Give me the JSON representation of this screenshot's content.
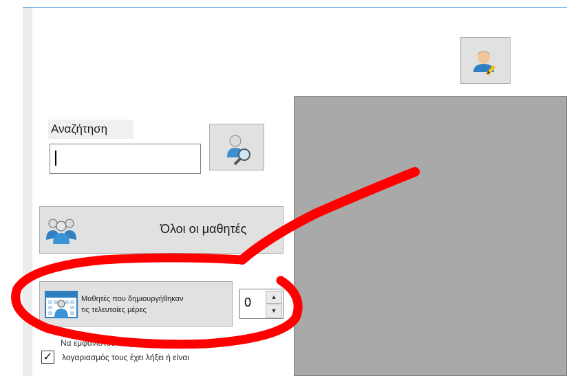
{
  "search": {
    "label": "Αναζήτηση",
    "value": "",
    "placeholder": ""
  },
  "buttons": {
    "all_students": "Όλοι οι μαθητές",
    "new_students_line1": "Μαθητές που δημιουργήθηκαν",
    "new_students_line2": "τις τελευταίες μέρες"
  },
  "days_spinner": {
    "value": "0",
    "up_glyph": "▲",
    "down_glyph": "▼"
  },
  "expired_filter": {
    "partial_text_above": "Να εμφανιστούν οι μαθητές που ο",
    "label": "λογαριασμός τους έχει λήξει ή είναι",
    "checked": true,
    "check_glyph": "✓"
  },
  "icons": {
    "edit_user": "user-edit-icon",
    "search_user": "user-search-icon",
    "all_students": "users-group-icon",
    "new_students": "users-calendar-icon"
  },
  "colors": {
    "panel_gray": "#a9a9a9",
    "accent_blue": "#3c8fe0",
    "annotation_red": "#ff0000"
  }
}
